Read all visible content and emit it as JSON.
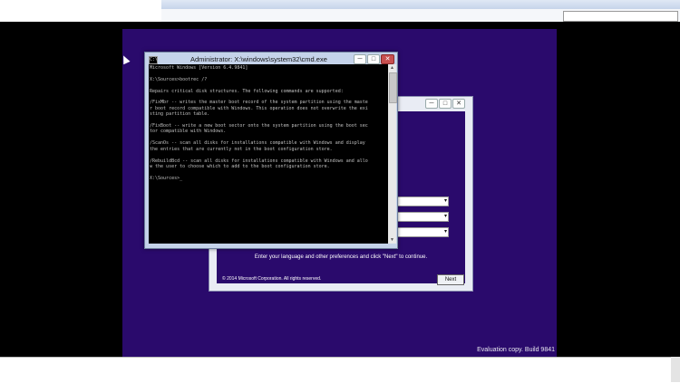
{
  "cmd": {
    "icon_text": "C:\\",
    "title": "Administrator: X:\\windows\\system32\\cmd.exe",
    "lines": [
      "Microsoft Windows [Version 6.4.9841]",
      "",
      "X:\\Sources>bootrec /?",
      "",
      "Repairs critical disk structures. The following commands are supported:",
      "",
      "/FixMbr -- writes the master boot record of the system partition using the maste",
      "r boot record compatible with Windows. This operation does not overwrite the exi",
      "sting partition table.",
      "",
      "/FixBoot -- write a new boot sector onto the system partition using the boot sec",
      "tor compatible with Windows.",
      "",
      "/ScanOs -- scan all disks for installations compatible with Windows and display",
      "the entries that are currently not in the boot configuration store.",
      "",
      "/RebuildBcd -- scan all disks for installations compatible with Windows and allo",
      "w the user to choose which to add to the boot configuration store.",
      "",
      "X:\\Sources>_"
    ],
    "caption_buttons": {
      "minimize": "─",
      "maximize": "□",
      "close": "✕"
    },
    "scroll": {
      "up": "▲",
      "down": "▼"
    }
  },
  "setup": {
    "caption_buttons": {
      "minimize": "─",
      "maximize": "□",
      "close": "✕"
    },
    "hint": "Enter your language and other preferences and click \"Next\" to continue.",
    "copyright": "© 2014 Microsoft Corporation. All rights reserved.",
    "next_label": "Next",
    "dropdown_arrow": "▾"
  },
  "desktop": {
    "evaluation": "Evaluation copy. Build 9841"
  },
  "icons": {
    "cursor": "mouse-pointer-icon",
    "cmd": "console-icon"
  }
}
